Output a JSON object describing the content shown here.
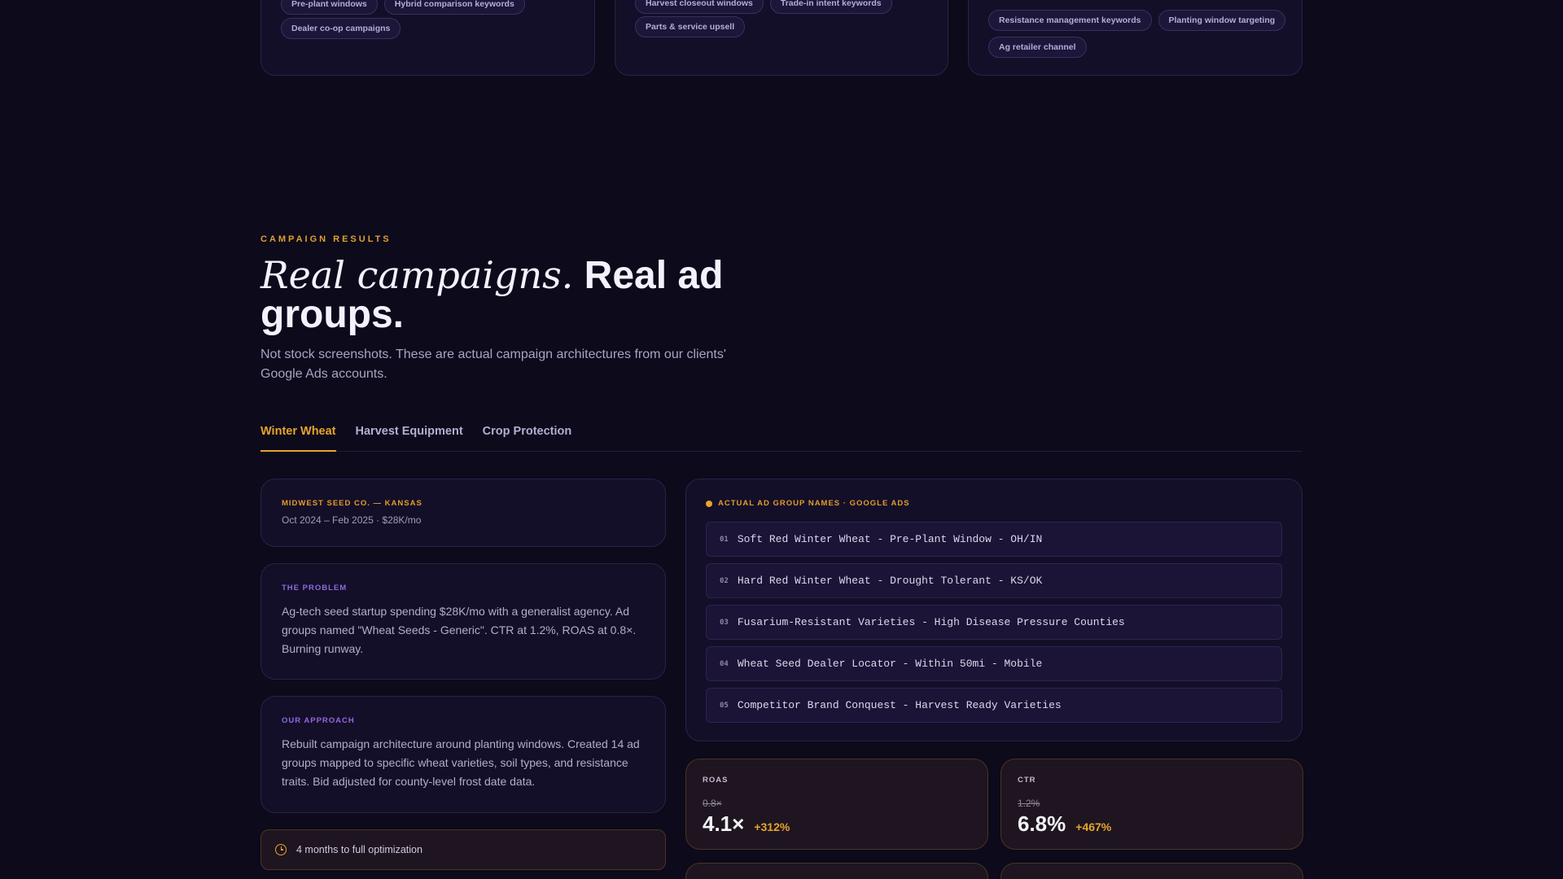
{
  "feature_cards": [
    {
      "chips_row1": [
        "Pre-plant windows",
        "Hybrid comparison keywords"
      ],
      "chips_row2": [
        "Dealer co-op campaigns"
      ]
    },
    {
      "chips_row1": [
        "Harvest closeout windows",
        "Trade-in intent keywords"
      ],
      "chips_row2": [
        "Parts & service upsell"
      ]
    },
    {
      "chips_row1": [
        "Resistance management keywords",
        "Planting window targeting"
      ],
      "chips_row2": [
        "Ag retailer channel"
      ]
    }
  ],
  "section": {
    "eyebrow": "CAMPAIGN RESULTS",
    "headline_italic": "Real campaigns.",
    "headline_bold": "Real ad groups.",
    "subtext": "Not stock screenshots. These are actual campaign architectures from our clients' Google Ads accounts."
  },
  "tabs": [
    {
      "label": "Winter Wheat",
      "active": true
    },
    {
      "label": "Harvest Equipment",
      "active": false
    },
    {
      "label": "Crop Protection",
      "active": false
    }
  ],
  "client": {
    "label": "MIDWEST SEED CO. — KANSAS",
    "meta": "Oct 2024 – Feb 2025 · $28K/mo"
  },
  "problem": {
    "label": "THE PROBLEM",
    "text": "Ag-tech seed startup spending $28K/mo with a generalist agency. Ad groups named \"Wheat Seeds - Generic\". CTR at 1.2%, ROAS at 0.8×. Burning runway."
  },
  "approach": {
    "label": "OUR APPROACH",
    "text": "Rebuilt campaign architecture around planting windows. Created 14 ad groups mapped to specific wheat varieties, soil types, and resistance traits. Bid adjusted for county-level frost date data."
  },
  "timeline": {
    "text": "4 months to full optimization",
    "icon": "clock-icon"
  },
  "ad_groups": {
    "title": "ACTUAL AD GROUP NAMES · GOOGLE ADS",
    "items": [
      {
        "num": "01",
        "name": "Soft Red Winter Wheat - Pre-Plant Window - OH/IN"
      },
      {
        "num": "02",
        "name": "Hard Red Winter Wheat - Drought Tolerant - KS/OK"
      },
      {
        "num": "03",
        "name": "Fusarium-Resistant Varieties - High Disease Pressure Counties"
      },
      {
        "num": "04",
        "name": "Wheat Seed Dealer Locator - Within 50mi - Mobile"
      },
      {
        "num": "05",
        "name": "Competitor Brand Conquest - Harvest Ready Varieties"
      }
    ]
  },
  "metrics": [
    {
      "label": "ROAS",
      "old": "0.8×",
      "value": "4.1×",
      "delta": "+312%"
    },
    {
      "label": "CTR",
      "old": "1.2%",
      "value": "6.8%",
      "delta": "+467%"
    }
  ],
  "colors": {
    "accent": "#e8a42c",
    "purple": "#9168e0",
    "bg": "#0c0a1b"
  }
}
